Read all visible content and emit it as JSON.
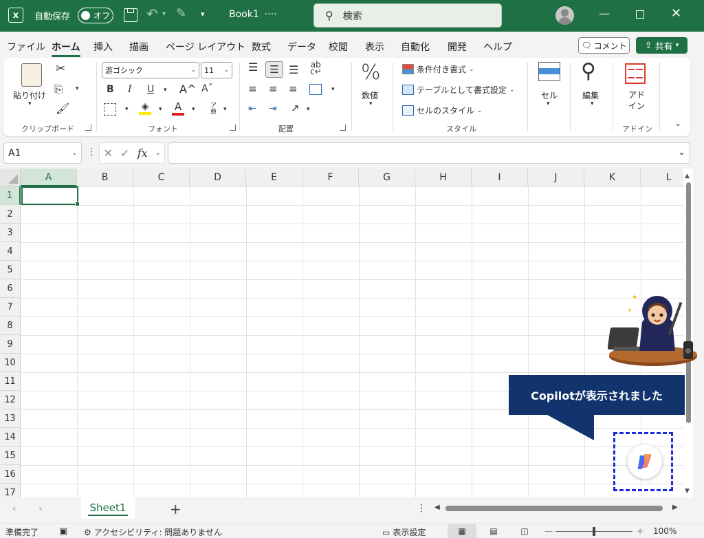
{
  "title_bar": {
    "app_icon": "excel-logo-icon",
    "autosave_label": "自動保存",
    "autosave_state": "オフ",
    "book_title": "Book1",
    "title_suffix": "····",
    "search_placeholder": "検索"
  },
  "menu": {
    "tabs": [
      "ファイル",
      "ホーム",
      "挿入",
      "描画",
      "ページ レイアウト",
      "数式",
      "データ",
      "校閲",
      "表示",
      "自動化",
      "開発",
      "ヘルプ"
    ],
    "active_tab": "ホーム",
    "comment_label": "コメント",
    "share_label": "共有"
  },
  "ribbon": {
    "clipboard": {
      "label": "クリップボード",
      "paste_label": "貼り付け"
    },
    "font": {
      "label": "フォント",
      "font_name": "游ゴシック",
      "font_size": "11",
      "bold": "B",
      "italic": "I",
      "underline": "U",
      "grow": "A^",
      "shrink": "Aˇ",
      "color_letter": "A",
      "phonetic": "ア亜"
    },
    "alignment": {
      "label": "配置"
    },
    "number": {
      "label": "数値",
      "symbol": "%"
    },
    "styles": {
      "label": "スタイル",
      "conditional": "条件付き書式",
      "table": "テーブルとして書式設定",
      "cell_styles": "セルのスタイル"
    },
    "cells": {
      "label": "セル"
    },
    "editing": {
      "label": "編集"
    },
    "addins": {
      "label": "アドイン",
      "button_line1": "アド",
      "button_line2": "イン"
    }
  },
  "formula_bar": {
    "name_box": "A1",
    "fx": "fx",
    "cancel_symbol": "✕",
    "enter_symbol": "✓",
    "formula_value": ""
  },
  "grid": {
    "columns": [
      "A",
      "B",
      "C",
      "D",
      "E",
      "F",
      "G",
      "H",
      "I",
      "J",
      "K",
      "L"
    ],
    "rows": [
      "1",
      "2",
      "3",
      "4",
      "5",
      "6",
      "7",
      "8",
      "9",
      "10",
      "11",
      "12",
      "13",
      "14",
      "15",
      "16",
      "17"
    ],
    "selected_column": "A",
    "selected_row": "1"
  },
  "overlay": {
    "callout_text": "Copilotが表示されました",
    "accent_color": "#10346b",
    "highlight_color": "#1a2bd8"
  },
  "sheets": {
    "tabs": [
      "Sheet1"
    ],
    "add_symbol": "+"
  },
  "status_bar": {
    "ready": "準備完了",
    "accessibility": "アクセシビリティ: 問題ありません",
    "display_settings": "表示設定",
    "zoom_minus": "—",
    "zoom_plus": "+",
    "zoom": "100%"
  },
  "colors": {
    "brand": "#1f7145",
    "selected_header": "#d3e4d9"
  }
}
